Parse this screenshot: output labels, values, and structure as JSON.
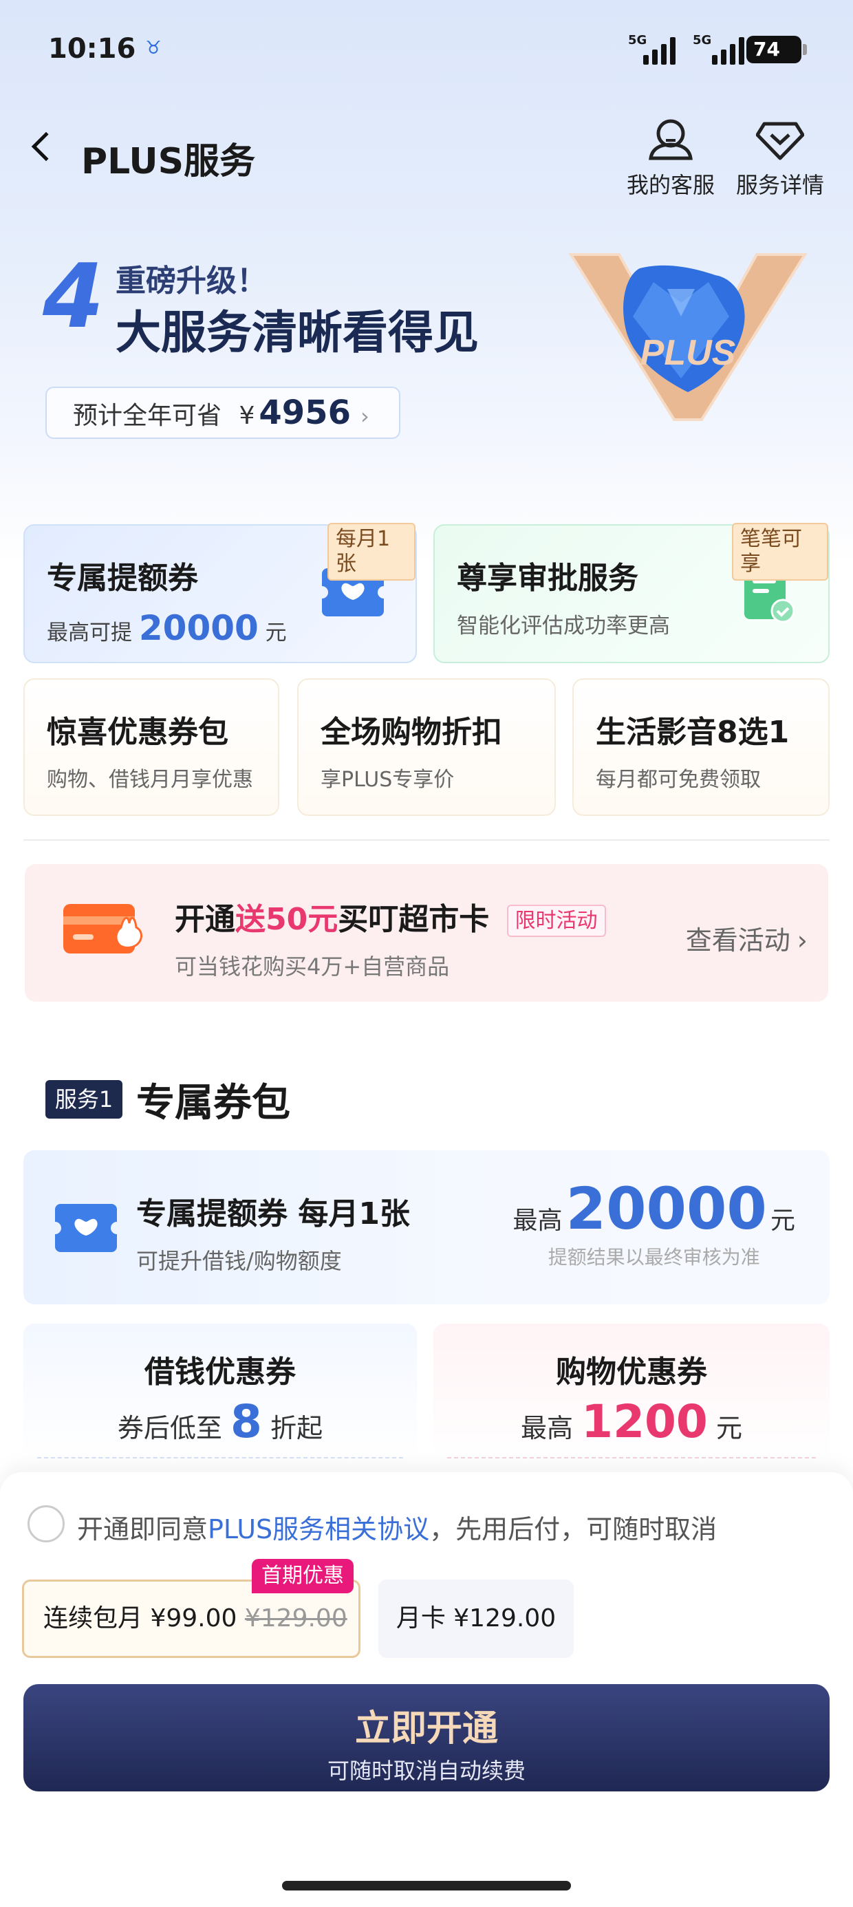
{
  "status_bar": {
    "time": "10:16",
    "app_icon": "meituan-icon",
    "net1": "5G",
    "net2": "5G",
    "battery": "74"
  },
  "nav": {
    "title": "PLUS服务",
    "service_label": "我的客服",
    "details_label": "服务详情"
  },
  "hero": {
    "number": "4",
    "subtitle": "重磅升级！",
    "headline": "大服务清晰看得见",
    "savings_label": "预计全年可省",
    "savings_currency": "¥",
    "savings_value": "4956",
    "badge_text": "PLUS"
  },
  "cards": {
    "quota": {
      "title": "专属提额券",
      "sub_prefix": "最高可提",
      "sub_value": "20000",
      "sub_suffix": "元",
      "tag": "每月1张"
    },
    "approval": {
      "title": "尊享审批服务",
      "sub": "智能化评估成功率更高",
      "tag": "笔笔可享"
    },
    "coupons": {
      "title": "惊喜优惠券包",
      "sub": "购物、借钱月月享优惠"
    },
    "discount": {
      "title": "全场购物折扣",
      "sub": "享PLUS专享价"
    },
    "media": {
      "title": "生活影音8选1",
      "sub": "每月都可免费领取"
    }
  },
  "promo": {
    "prefix": "开通",
    "highlight": "送50元",
    "suffix": "买叮超市卡",
    "tag": "限时活动",
    "sub": "可当钱花购买4万+自营商品",
    "link": "查看活动"
  },
  "section1": {
    "badge": "服务1",
    "title": "专属券包",
    "coupon": {
      "title": "专属提额券 每月1张",
      "sub": "可提升借钱/购物额度",
      "max_prefix": "最高",
      "max_value": "20000",
      "max_unit": "元",
      "note": "提额结果以最终审核为准"
    },
    "loan": {
      "title": "借钱优惠券",
      "prefix": "券后低至",
      "value": "8",
      "suffix": "折起"
    },
    "shop": {
      "title": "购物优惠券",
      "prefix": "最高",
      "value": "1200",
      "suffix": "元"
    }
  },
  "bottom": {
    "agree_prefix": "开通即同意",
    "agree_link": "PLUS服务相关协议",
    "agree_suffix": "，先用后付，可随时取消",
    "plan1": {
      "label": "连续包月 ¥99.00",
      "original": "¥129.00",
      "tag": "首期优惠"
    },
    "plan2": {
      "label": "月卡 ¥129.00"
    },
    "cta": "立即开通",
    "cta_sub": "可随时取消自动续费"
  },
  "colors": {
    "accent": "#3d6fe0",
    "pink": "#e8386e",
    "navy": "#1d2a4e"
  }
}
